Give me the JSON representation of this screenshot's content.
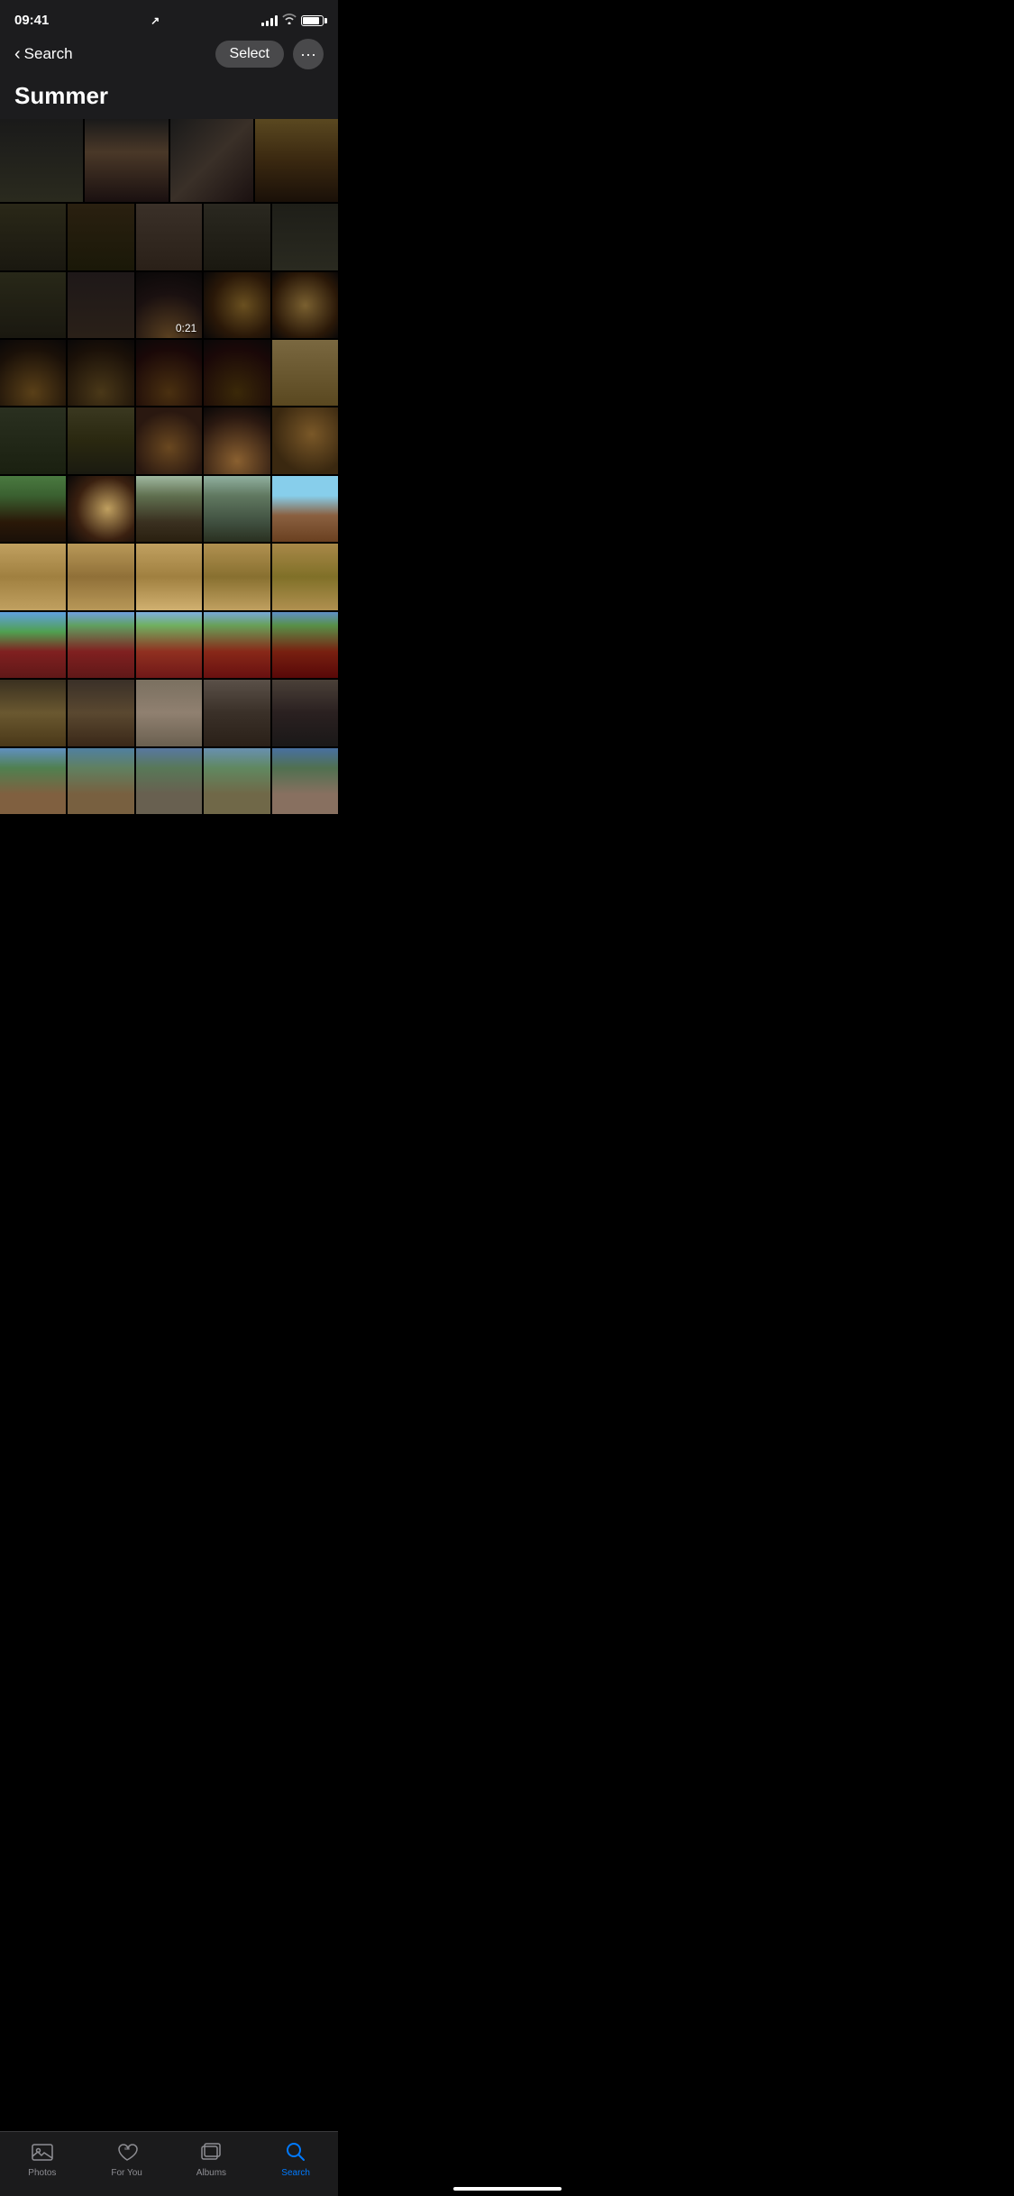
{
  "statusBar": {
    "time": "09:41",
    "locationIcon": "↗",
    "signalBars": 4,
    "wifiConnected": true,
    "batteryLevel": 85
  },
  "navBar": {
    "backLabel": "Search",
    "selectLabel": "Select",
    "moreLabel": "···"
  },
  "section": {
    "title": "Summer"
  },
  "videoLabel": "0:21",
  "tabBar": {
    "items": [
      {
        "id": "photos",
        "label": "Photos",
        "active": false
      },
      {
        "id": "for-you",
        "label": "For You",
        "active": false
      },
      {
        "id": "albums",
        "label": "Albums",
        "active": false
      },
      {
        "id": "search",
        "label": "Search",
        "active": true
      }
    ]
  },
  "homeIndicator": true
}
